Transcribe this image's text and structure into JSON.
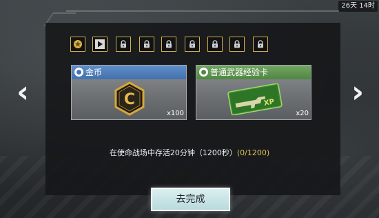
{
  "timer": "26天 14时",
  "tabs": [
    {
      "icon": "star-coin-icon",
      "state": "completed"
    },
    {
      "icon": "play-icon",
      "state": "active"
    },
    {
      "icon": "lock-icon",
      "state": "locked"
    },
    {
      "icon": "lock-icon",
      "state": "locked"
    },
    {
      "icon": "lock-icon",
      "state": "locked"
    },
    {
      "icon": "lock-icon",
      "state": "locked"
    },
    {
      "icon": "lock-icon",
      "state": "locked"
    },
    {
      "icon": "lock-icon",
      "state": "locked"
    },
    {
      "icon": "lock-icon",
      "state": "locked"
    }
  ],
  "rewards": [
    {
      "name": "金币",
      "quantity": "x100",
      "icon": "c-coin-icon",
      "header_color": "#4f7fbd"
    },
    {
      "name": "普通武器经验卡",
      "quantity": "x20",
      "icon": "weapon-xp-card-icon",
      "icon_text": "XP",
      "header_color": "#5f9650"
    }
  ],
  "task": {
    "description": "在使命战场中存活20分钟（1200秒）",
    "progress": "(0/1200)"
  },
  "go_button": {
    "label": "去完成"
  },
  "colors": {
    "accent_gold": "#d8b24a",
    "progress_text": "#e2c256"
  }
}
